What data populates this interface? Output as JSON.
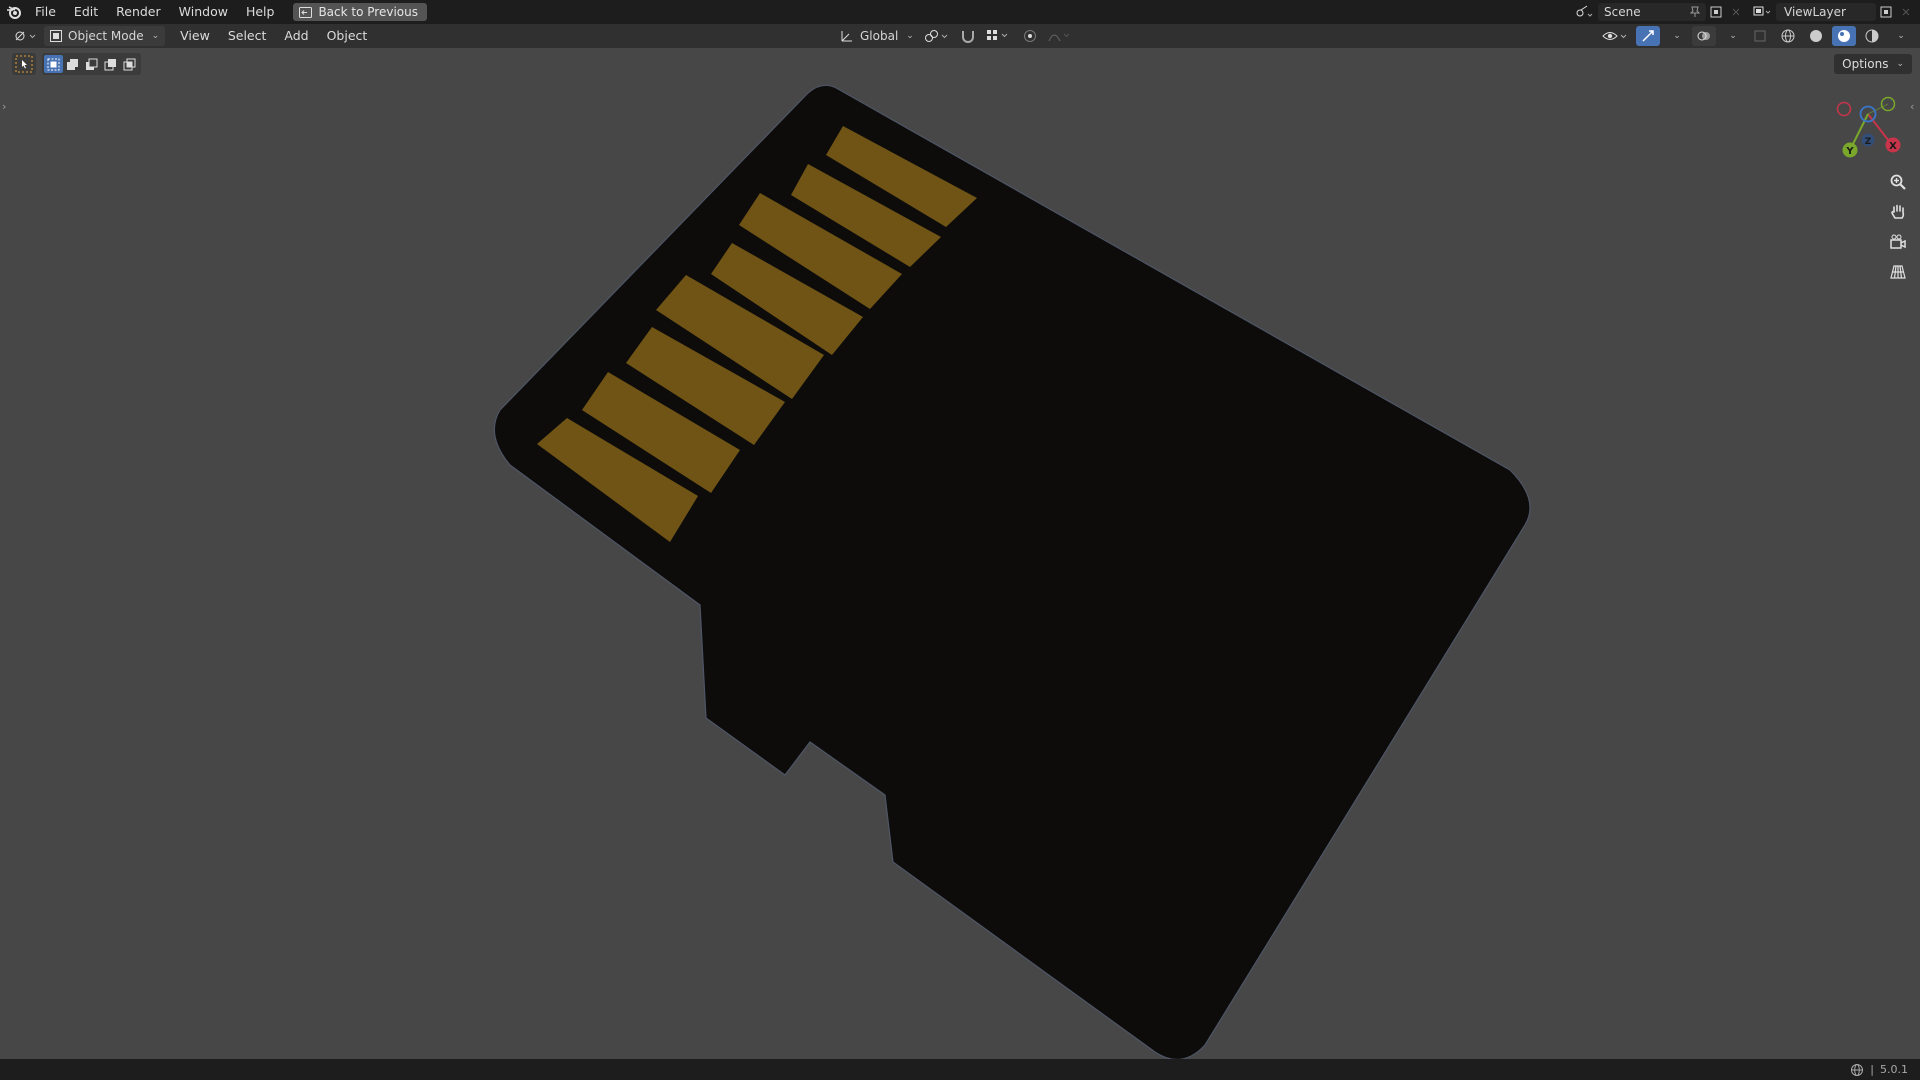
{
  "menubar": {
    "items": [
      "File",
      "Edit",
      "Render",
      "Window",
      "Help"
    ],
    "back_button": "Back to Previous"
  },
  "scene": {
    "name": "Scene"
  },
  "view_layer": {
    "name": "ViewLayer"
  },
  "viewport_header": {
    "mode": "Object Mode",
    "menus": [
      "View",
      "Select",
      "Add",
      "Object"
    ],
    "transform_orientation": "Global"
  },
  "options_label": "Options",
  "gizmo": {
    "x_label": "X",
    "y_label": "Y",
    "z_label": "Z"
  },
  "status": {
    "version": "5.0.1"
  },
  "colors": {
    "accent": "#4772b3",
    "card_body": "#0d0c0a",
    "contacts": "#6f5416",
    "axis_x": "#c8344a",
    "axis_y": "#7aa82a",
    "axis_z": "#3a76c9"
  }
}
